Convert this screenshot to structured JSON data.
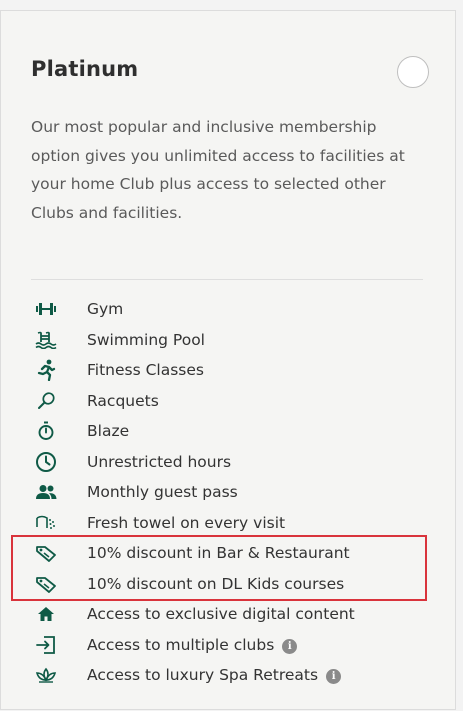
{
  "plan": {
    "title": "Platinum",
    "description": "Our most popular and inclusive membership option gives you unlimited access to facilities at your home Club plus access to selected other Clubs and facilities.",
    "features": [
      {
        "label": "Gym",
        "icon": "dumbbell-icon",
        "info": false
      },
      {
        "label": "Swimming Pool",
        "icon": "swimming-pool-icon",
        "info": false
      },
      {
        "label": "Fitness Classes",
        "icon": "running-person-icon",
        "info": false
      },
      {
        "label": "Racquets",
        "icon": "racquet-icon",
        "info": false
      },
      {
        "label": "Blaze",
        "icon": "stopwatch-icon",
        "info": false
      },
      {
        "label": "Unrestricted hours",
        "icon": "clock-icon",
        "info": false
      },
      {
        "label": "Monthly guest pass",
        "icon": "people-icon",
        "info": false
      },
      {
        "label": "Fresh towel on every visit",
        "icon": "towel-icon",
        "info": false
      },
      {
        "label": "10% discount in Bar & Restaurant",
        "icon": "discount-tag-icon",
        "info": false
      },
      {
        "label": "10% discount on DL Kids courses",
        "icon": "discount-tag-icon",
        "info": false
      },
      {
        "label": "Access to exclusive digital content",
        "icon": "home-icon",
        "info": false
      },
      {
        "label": "Access to multiple clubs",
        "icon": "enter-door-icon",
        "info": true
      },
      {
        "label": "Access to luxury Spa Retreats",
        "icon": "lotus-icon",
        "info": true
      }
    ]
  },
  "colors": {
    "icon_green": "#0f5a46",
    "highlight_red": "#d9333b"
  }
}
